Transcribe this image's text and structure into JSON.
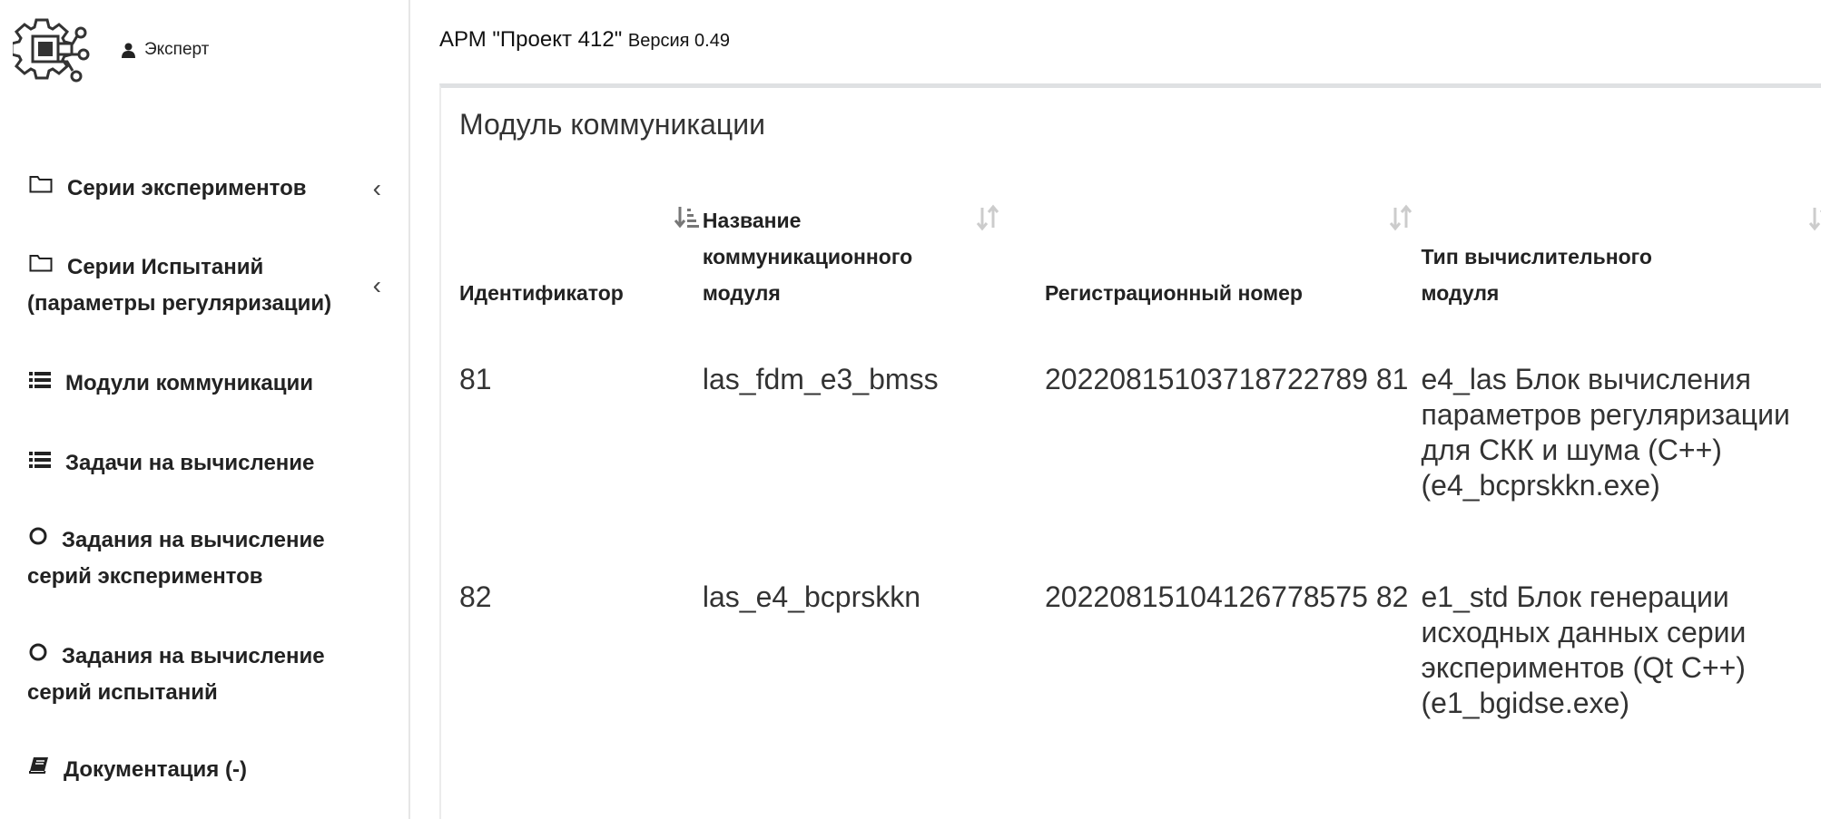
{
  "header": {
    "user_label": "Эксперт",
    "app_title": "АРМ \"Проект 412\"",
    "version": "Версия 0.49"
  },
  "sidebar": {
    "items": [
      {
        "label": "Серии экспериментов",
        "icon": "folder-icon",
        "has_chevron": true
      },
      {
        "label": "Серии Испытаний",
        "label2": "(параметры регуляризации)",
        "icon": "folder-icon",
        "has_chevron": true
      },
      {
        "label": "Модули коммуникации",
        "icon": "list-icon"
      },
      {
        "label": "Задачи на вычисление",
        "icon": "list-icon"
      },
      {
        "label": "Задания на вычисление",
        "label2": "серий экспериментов",
        "icon": "circle-icon"
      },
      {
        "label": "Задания на вычисление",
        "label2": "серий испытаний",
        "icon": "circle-icon"
      },
      {
        "label": "Документация (-)",
        "icon": "book-icon"
      }
    ],
    "chevron": "‹"
  },
  "main": {
    "title": "Модуль коммуникации",
    "columns": [
      {
        "label": "Идентификатор"
      },
      {
        "label": "Название коммуникационного модуля"
      },
      {
        "label": "Регистрационный номер"
      },
      {
        "label": "Тип вычислительного модуля"
      }
    ],
    "rows": [
      {
        "id": "81",
        "name": "las_fdm_e3_bmss",
        "reg": "20220815103718722789 81",
        "type": "e4_las Блок вычисления параметров регуляризации для СКК и шума (C++) (e4_bcprskkn.exe)"
      },
      {
        "id": "82",
        "name": "las_e4_bcprskkn",
        "reg": "20220815104126778575 82",
        "type": "e1_std Блок генерации исходных данных серии экспериментов (Qt C++) (e1_bgidse.exe)"
      }
    ]
  }
}
